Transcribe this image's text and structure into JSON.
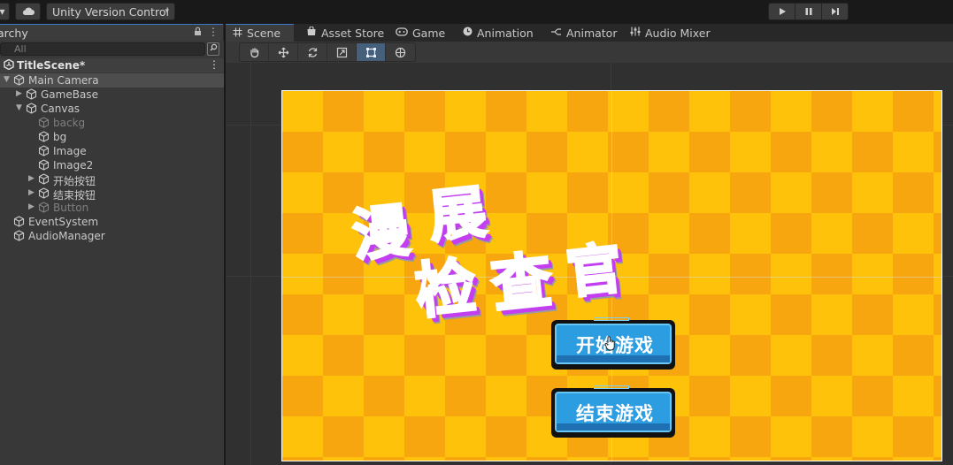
{
  "toolbar": {
    "version_control_label": "Unity Version Control",
    "dropdown_arrow": "▾"
  },
  "hierarchy": {
    "tab_label": "archy",
    "search_placeholder": "All",
    "scene_name": "TitleScene*",
    "items": [
      {
        "label": "Main Camera",
        "selected": true,
        "dim": false
      },
      {
        "label": "GameBase",
        "dim": false
      },
      {
        "label": "Canvas",
        "dim": false
      },
      {
        "label": "backg",
        "dim": true
      },
      {
        "label": "bg",
        "dim": false
      },
      {
        "label": "Image",
        "dim": false
      },
      {
        "label": "Image2",
        "dim": false
      },
      {
        "label": "开始按钮",
        "dim": false
      },
      {
        "label": "结束按钮",
        "dim": false
      },
      {
        "label": "Button",
        "dim": true
      },
      {
        "label": "EventSystem",
        "dim": false
      },
      {
        "label": "AudioManager",
        "dim": false
      }
    ]
  },
  "scene_tabs": [
    {
      "label": "Scene",
      "icon": "grid-icon"
    },
    {
      "label": "Asset Store",
      "icon": "store-icon"
    },
    {
      "label": "Game",
      "icon": "gamepad-icon"
    },
    {
      "label": "Animation",
      "icon": "clock-icon"
    },
    {
      "label": "Animator",
      "icon": "animator-icon"
    },
    {
      "label": "Audio Mixer",
      "icon": "mixer-icon"
    }
  ],
  "scene_tools": [
    "hand-tool-icon",
    "move-tool-icon",
    "rotate-tool-icon",
    "scale-tool-icon",
    "rect-tool-icon",
    "transform-tool-icon"
  ],
  "game": {
    "logo_chars": [
      "漫",
      "展",
      "检",
      "查",
      "官"
    ],
    "start_button": "开始游戏",
    "end_button": "结束游戏"
  },
  "colors": {
    "accent": "#3a7acc",
    "game_bg_light": "#ffc20a",
    "game_bg_dark": "#f7a60f",
    "logo_fill": "#f59a12",
    "logo_shadow": "#c23ef0",
    "button_fill": "#2b9de0"
  }
}
